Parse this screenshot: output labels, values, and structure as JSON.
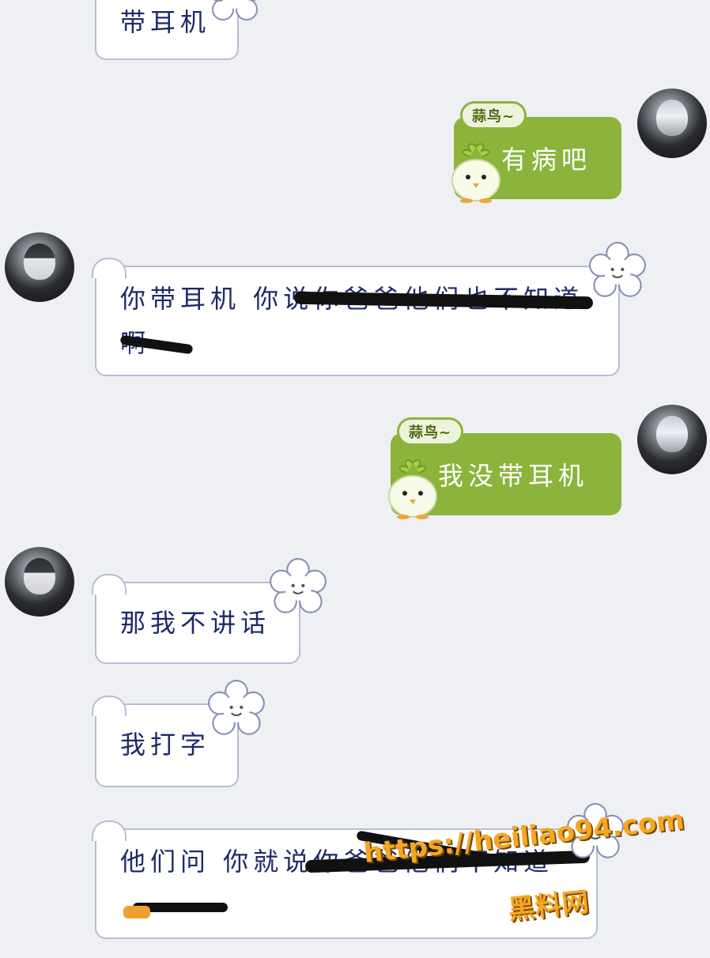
{
  "messages": {
    "m0": "带耳机",
    "m1_tag": "蒜鸟~",
    "m1": "有病吧",
    "m2_line1": "你带耳机 你说你爸爸他们也不知道",
    "m2_line2": "啊",
    "m3_tag": "蒜鸟~",
    "m3": "我没带耳机",
    "m4": "那我不讲话",
    "m5": "我打字",
    "m6_line1": "他们问 你就说你爸爸他们不知道"
  },
  "watermark": {
    "url": "https://heiliao94.com",
    "site": "黑料网"
  },
  "colors": {
    "background": "#eef0f3",
    "bubble_border": "#b9bdd6",
    "text": "#1f2a6b",
    "green_bubble": "#8cb43c",
    "watermark": "#f5a623"
  },
  "icons": [
    "avatar-icon",
    "flower-sticker-icon",
    "chick-sticker-icon"
  ]
}
